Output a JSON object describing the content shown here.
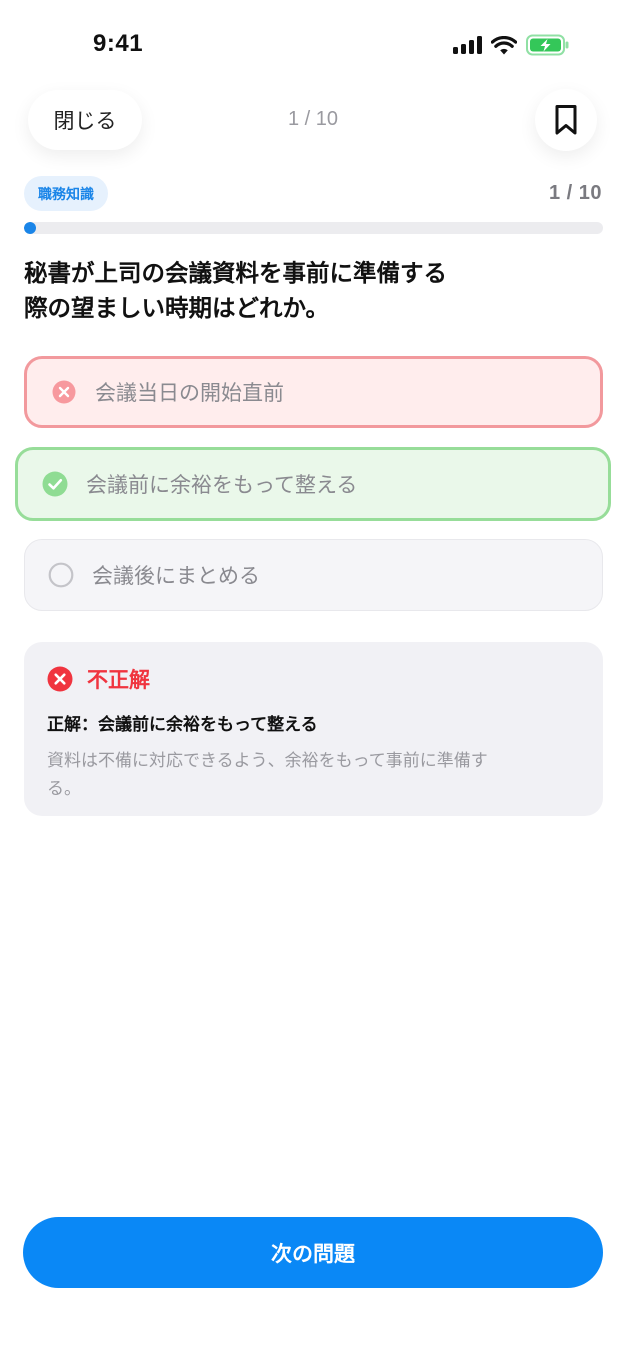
{
  "status_bar": {
    "time": "9:41"
  },
  "nav": {
    "close_label": "閉じる",
    "progress": "1 / 10"
  },
  "quiz": {
    "category": "職務知識",
    "counter": "1 / 10",
    "progress_fraction": 0.1,
    "question": "秘書が上司の会議資料を事前に準備する際の望ましい時期はどれか。",
    "options": [
      {
        "label": "会議当日の開始直前",
        "state": "wrong"
      },
      {
        "label": "会議前に余裕をもって整える",
        "state": "correct"
      },
      {
        "label": "会議後にまとめる",
        "state": "unselected"
      }
    ]
  },
  "feedback": {
    "status": "不正解",
    "correct_answer": "正解：会議前に余裕をもって整える",
    "explanation": "資料は不備に対応できるよう、余裕をもって事前に準備する。"
  },
  "next_button": {
    "label": "次の問題"
  },
  "colors": {
    "accent": "#0a88f6",
    "wrong": "#f0343f",
    "correct": "#34c759"
  }
}
